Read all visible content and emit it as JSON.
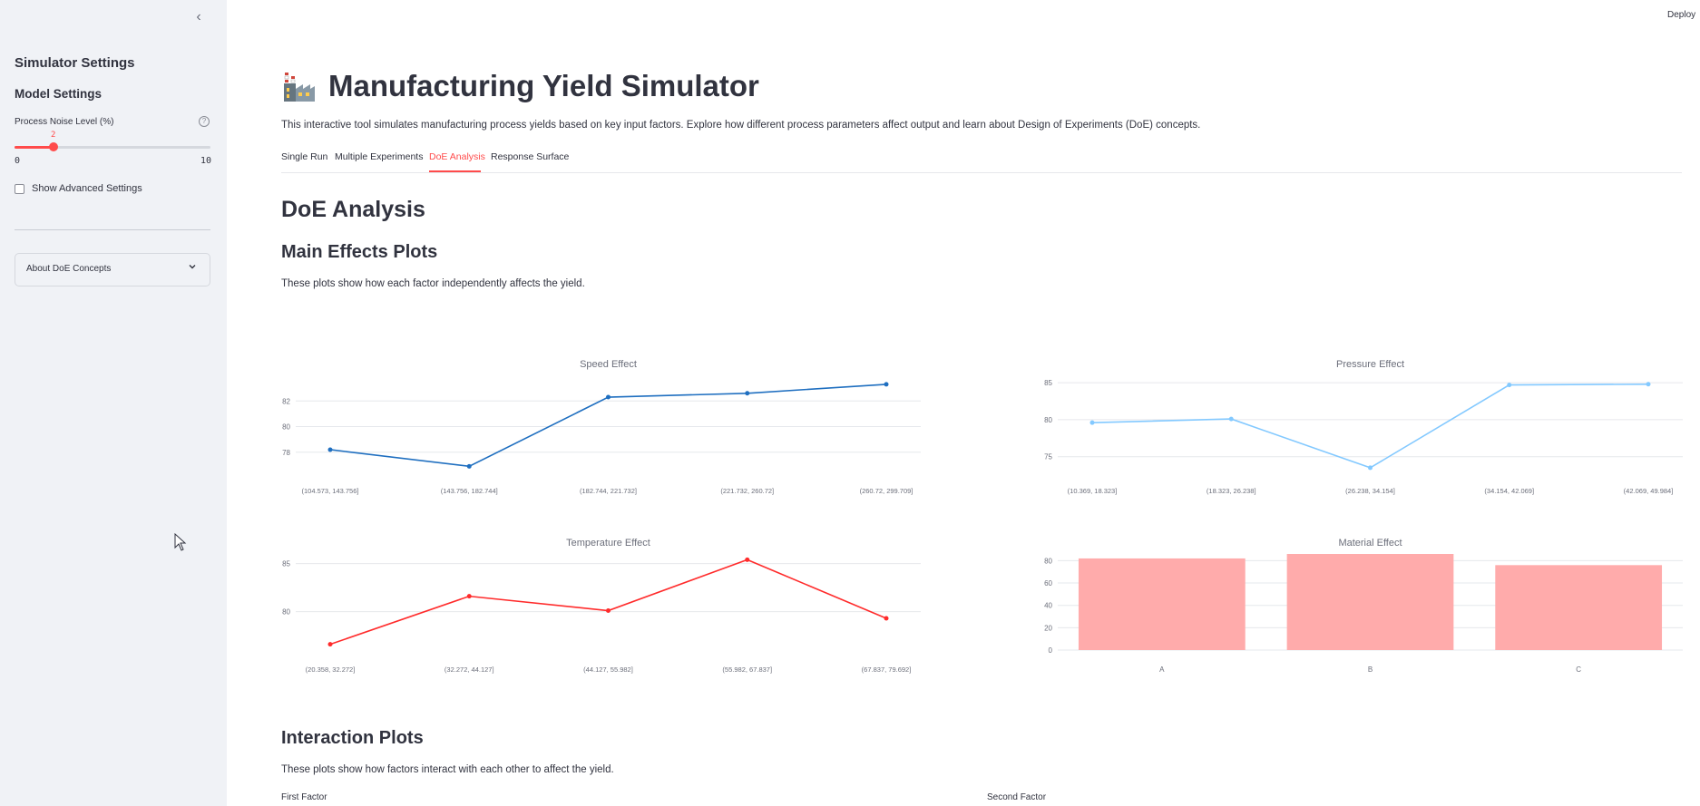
{
  "header": {
    "deploy_label": "Deploy"
  },
  "sidebar": {
    "collapse_glyph": "‹",
    "title": "Simulator Settings",
    "model_settings": "Model Settings",
    "noise_slider": {
      "label": "Process Noise Level (%)",
      "value": "2",
      "min": "0",
      "max": "10",
      "fraction": 0.2
    },
    "help_glyph": "?",
    "advanced_checkbox": {
      "label": "Show Advanced Settings",
      "checked": false
    },
    "expander": {
      "label": "About DoE Concepts"
    }
  },
  "page": {
    "title": "Manufacturing Yield Simulator",
    "intro": "This interactive tool simulates manufacturing process yields based on key input factors. Explore how different process parameters affect output and learn about Design of Experiments (DoE) concepts.",
    "tabs": [
      {
        "label": "Single Run",
        "active": false
      },
      {
        "label": "Multiple Experiments",
        "active": false
      },
      {
        "label": "DoE Analysis",
        "active": true
      },
      {
        "label": "Response Surface",
        "active": false
      }
    ],
    "section_title": "DoE Analysis",
    "main_effects_title": "Main Effects Plots",
    "main_effects_desc": "These plots show how each factor independently affects the yield.",
    "interaction_title": "Interaction Plots",
    "interaction_desc": "These plots show how factors interact with each other to affect the yield.",
    "first_factor_label": "First Factor",
    "second_factor_label": "Second Factor"
  },
  "colors": {
    "accent": "#ff4b4b",
    "speed": "#1f6fc0",
    "pressure": "#83c9ff",
    "temperature": "#ff2b2b",
    "material": "#ffabab"
  },
  "chart_data": [
    {
      "type": "line",
      "title": "Speed Effect",
      "categories": [
        "(104.573, 143.756]",
        "(143.756, 182.744]",
        "(182.744, 221.732]",
        "(221.732, 260.72]",
        "(260.72, 299.709]"
      ],
      "values": [
        78.2,
        76.9,
        82.3,
        82.6,
        83.3
      ],
      "yticks": [
        78,
        80,
        82
      ],
      "ylim": [
        76.5,
        84.0
      ],
      "color": "#1f6fc0"
    },
    {
      "type": "line",
      "title": "Pressure Effect",
      "categories": [
        "(10.369, 18.323]",
        "(18.323, 26.238]",
        "(26.238, 34.154]",
        "(34.154, 42.069]",
        "(42.069, 49.984]"
      ],
      "values": [
        79.6,
        80.1,
        73.5,
        84.7,
        84.8
      ],
      "yticks": [
        75,
        80,
        85
      ],
      "ylim": [
        73.0,
        86.0
      ],
      "color": "#83c9ff"
    },
    {
      "type": "line",
      "title": "Temperature Effect",
      "categories": [
        "(20.358, 32.272]",
        "(32.272, 44.127]",
        "(44.127, 55.982]",
        "(55.982, 67.837]",
        "(67.837, 79.692]"
      ],
      "values": [
        76.6,
        81.6,
        80.1,
        85.4,
        79.3
      ],
      "yticks": [
        80,
        85
      ],
      "ylim": [
        76.0,
        86.0
      ],
      "color": "#ff2b2b"
    },
    {
      "type": "bar",
      "title": "Material Effect",
      "categories": [
        "A",
        "B",
        "C"
      ],
      "values": [
        82,
        86,
        76
      ],
      "yticks": [
        0,
        20,
        40,
        60,
        80
      ],
      "ylim": [
        0,
        86
      ],
      "color": "#ffabab"
    }
  ]
}
